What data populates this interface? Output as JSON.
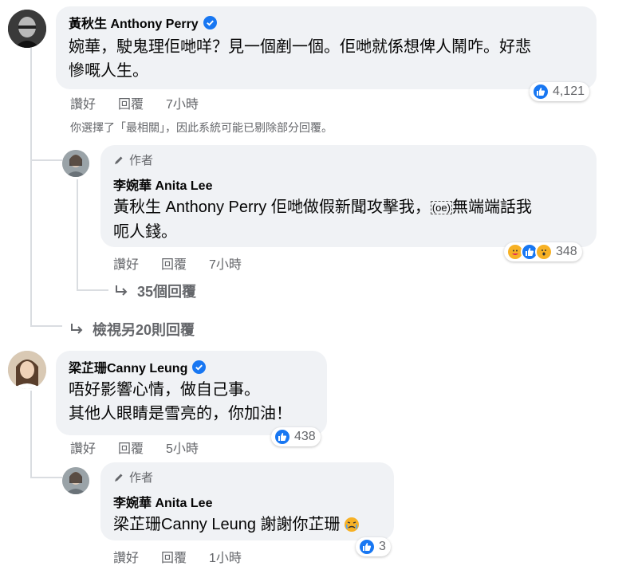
{
  "comments": [
    {
      "author": "黃秋生 Anthony Perry",
      "text_lines": [
        "婉華，駛鬼理佢哋咩？見一個剷一個。佢哋就係想俾人鬧咋。好悲",
        "慘嘅人生。"
      ],
      "actions": [
        "讚好",
        "回覆",
        "7小時"
      ],
      "reaction_count": "4,121",
      "note": "你選擇了「最相關」，因此系統可能已剔除部分回覆。"
    },
    {
      "author_label": "作者",
      "author": "李婉華 Anita Lee",
      "text_lines": [
        "黃秋生 Anthony Perry 佢哋做假新聞攻擊我，",
        "呃人錢。"
      ],
      "text_special": "(oe)",
      "text_line1_tail": "無端端話我",
      "actions": [
        "讚好",
        "回覆",
        "7小時"
      ],
      "reaction_count": "348",
      "replies_link": "35個回覆"
    },
    {
      "view_more": "檢視另20則回覆"
    },
    {
      "author": "梁芷珊Canny Leung",
      "text_lines": [
        "唔好影響心情，做自己事。",
        "其他人眼睛是雪亮的，你加油！"
      ],
      "actions": [
        "讚好",
        "回覆",
        "5小時"
      ],
      "reaction_count": "438"
    },
    {
      "author_label": "作者",
      "author": "李婉華 Anita Lee",
      "text_lines": [
        "梁芷珊Canny Leung 謝謝你芷珊"
      ],
      "actions": [
        "讚好",
        "回覆",
        "1小時"
      ],
      "reaction_count": "3"
    }
  ],
  "colors": {
    "bubble": "#f0f2f5",
    "like_blue": "#1877f2",
    "meta_gray": "#65676b",
    "thread_line": "#dadde1"
  }
}
